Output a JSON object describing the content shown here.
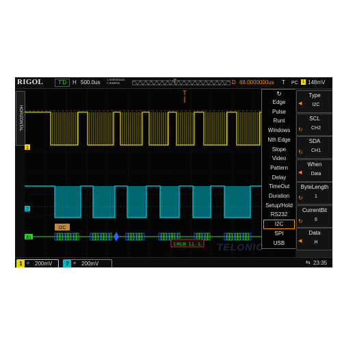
{
  "colors": {
    "ch1": "#e8d800",
    "ch2": "#00b8c8",
    "trigger": "#ff8c00",
    "decode_green": "#26d626",
    "decode_blue": "#2f5fff"
  },
  "topbar": {
    "logo": "RIGOL",
    "run_state": "T'D",
    "h_label": "H",
    "timebase": "500.0us",
    "sample_rate": "1.0000GSa/s 7.00MPts",
    "trigger_marker": "T",
    "d_label": "D",
    "delay": "68.0000000us",
    "t_label": "T",
    "trigger_type_label": "PC",
    "trigger_source": "1",
    "trigger_level": "148mV"
  },
  "left_strip": {
    "label": "HORIZONTAL"
  },
  "channel_markers": {
    "ch1": "1",
    "ch2": "2",
    "trigger": "T",
    "bus": "B1"
  },
  "bus": {
    "label": "I2C",
    "decode_readout": "LHLH LL L"
  },
  "trigger_menu": {
    "icon": "knob-arrow-icon",
    "items": [
      "Edge",
      "Pulse",
      "Runt",
      "Windows",
      "Nth Edge",
      "Slope",
      "Video",
      "Pattern",
      "Delay",
      "TimeOut",
      "Duration",
      "Setup/Hold",
      "RS232",
      "I2C",
      "SPI",
      "USB"
    ],
    "selected": "I2C"
  },
  "softkeys": [
    {
      "title": "Type",
      "value": "I2C"
    },
    {
      "title": "SCL",
      "value": "CH2"
    },
    {
      "title": "SDA",
      "value": "CH1"
    },
    {
      "title": "When",
      "value": "Data"
    },
    {
      "title": "ByteLength",
      "value": "1"
    },
    {
      "title": "CurrentBit",
      "value": "6"
    },
    {
      "title": "Data",
      "value": "H"
    }
  ],
  "bottombar": {
    "ch1": {
      "num": "1",
      "coupling": "=",
      "scale": "200mV"
    },
    "ch2": {
      "num": "2",
      "coupling": "=",
      "scale": "200mV"
    },
    "usb_icon": "usb-icon",
    "time": "23:35"
  },
  "watermark": "TELONIC"
}
